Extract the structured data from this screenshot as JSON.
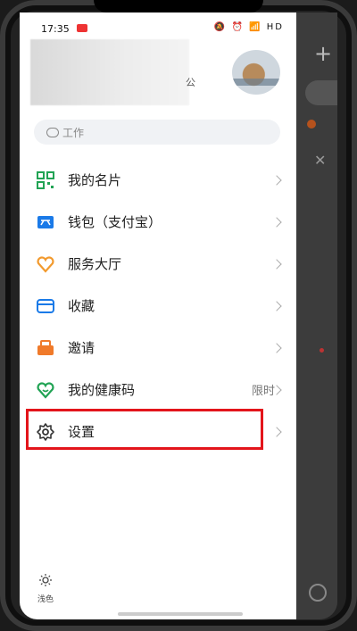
{
  "status_bar": {
    "time": "17:35",
    "icons": "🔕 ⏰ 📶 HD"
  },
  "profile": {
    "name_tail": "公",
    "avatar": "avatar-photo"
  },
  "status_pill": {
    "icon": "chat-bubble-icon",
    "label": "工作"
  },
  "menu": {
    "items": [
      {
        "label": "我的名片",
        "icon": "qr-card-icon",
        "extra": ""
      },
      {
        "label": "钱包（支付宝）",
        "icon": "wallet-icon",
        "extra": ""
      },
      {
        "label": "服务大厅",
        "icon": "heart-hands-icon",
        "extra": ""
      },
      {
        "label": "收藏",
        "icon": "box-icon",
        "extra": ""
      },
      {
        "label": "邀请",
        "icon": "invite-icon",
        "extra": ""
      },
      {
        "label": "我的健康码",
        "icon": "smile-icon",
        "extra": "限时"
      },
      {
        "label": "设置",
        "icon": "gear-icon",
        "extra": ""
      }
    ]
  },
  "theme": {
    "label": "浅色",
    "icon": "sun-icon"
  },
  "colors": {
    "highlight": "#e3151b",
    "green": "#21a354",
    "blue": "#1a7ae8",
    "orange": "#f29a2e"
  }
}
